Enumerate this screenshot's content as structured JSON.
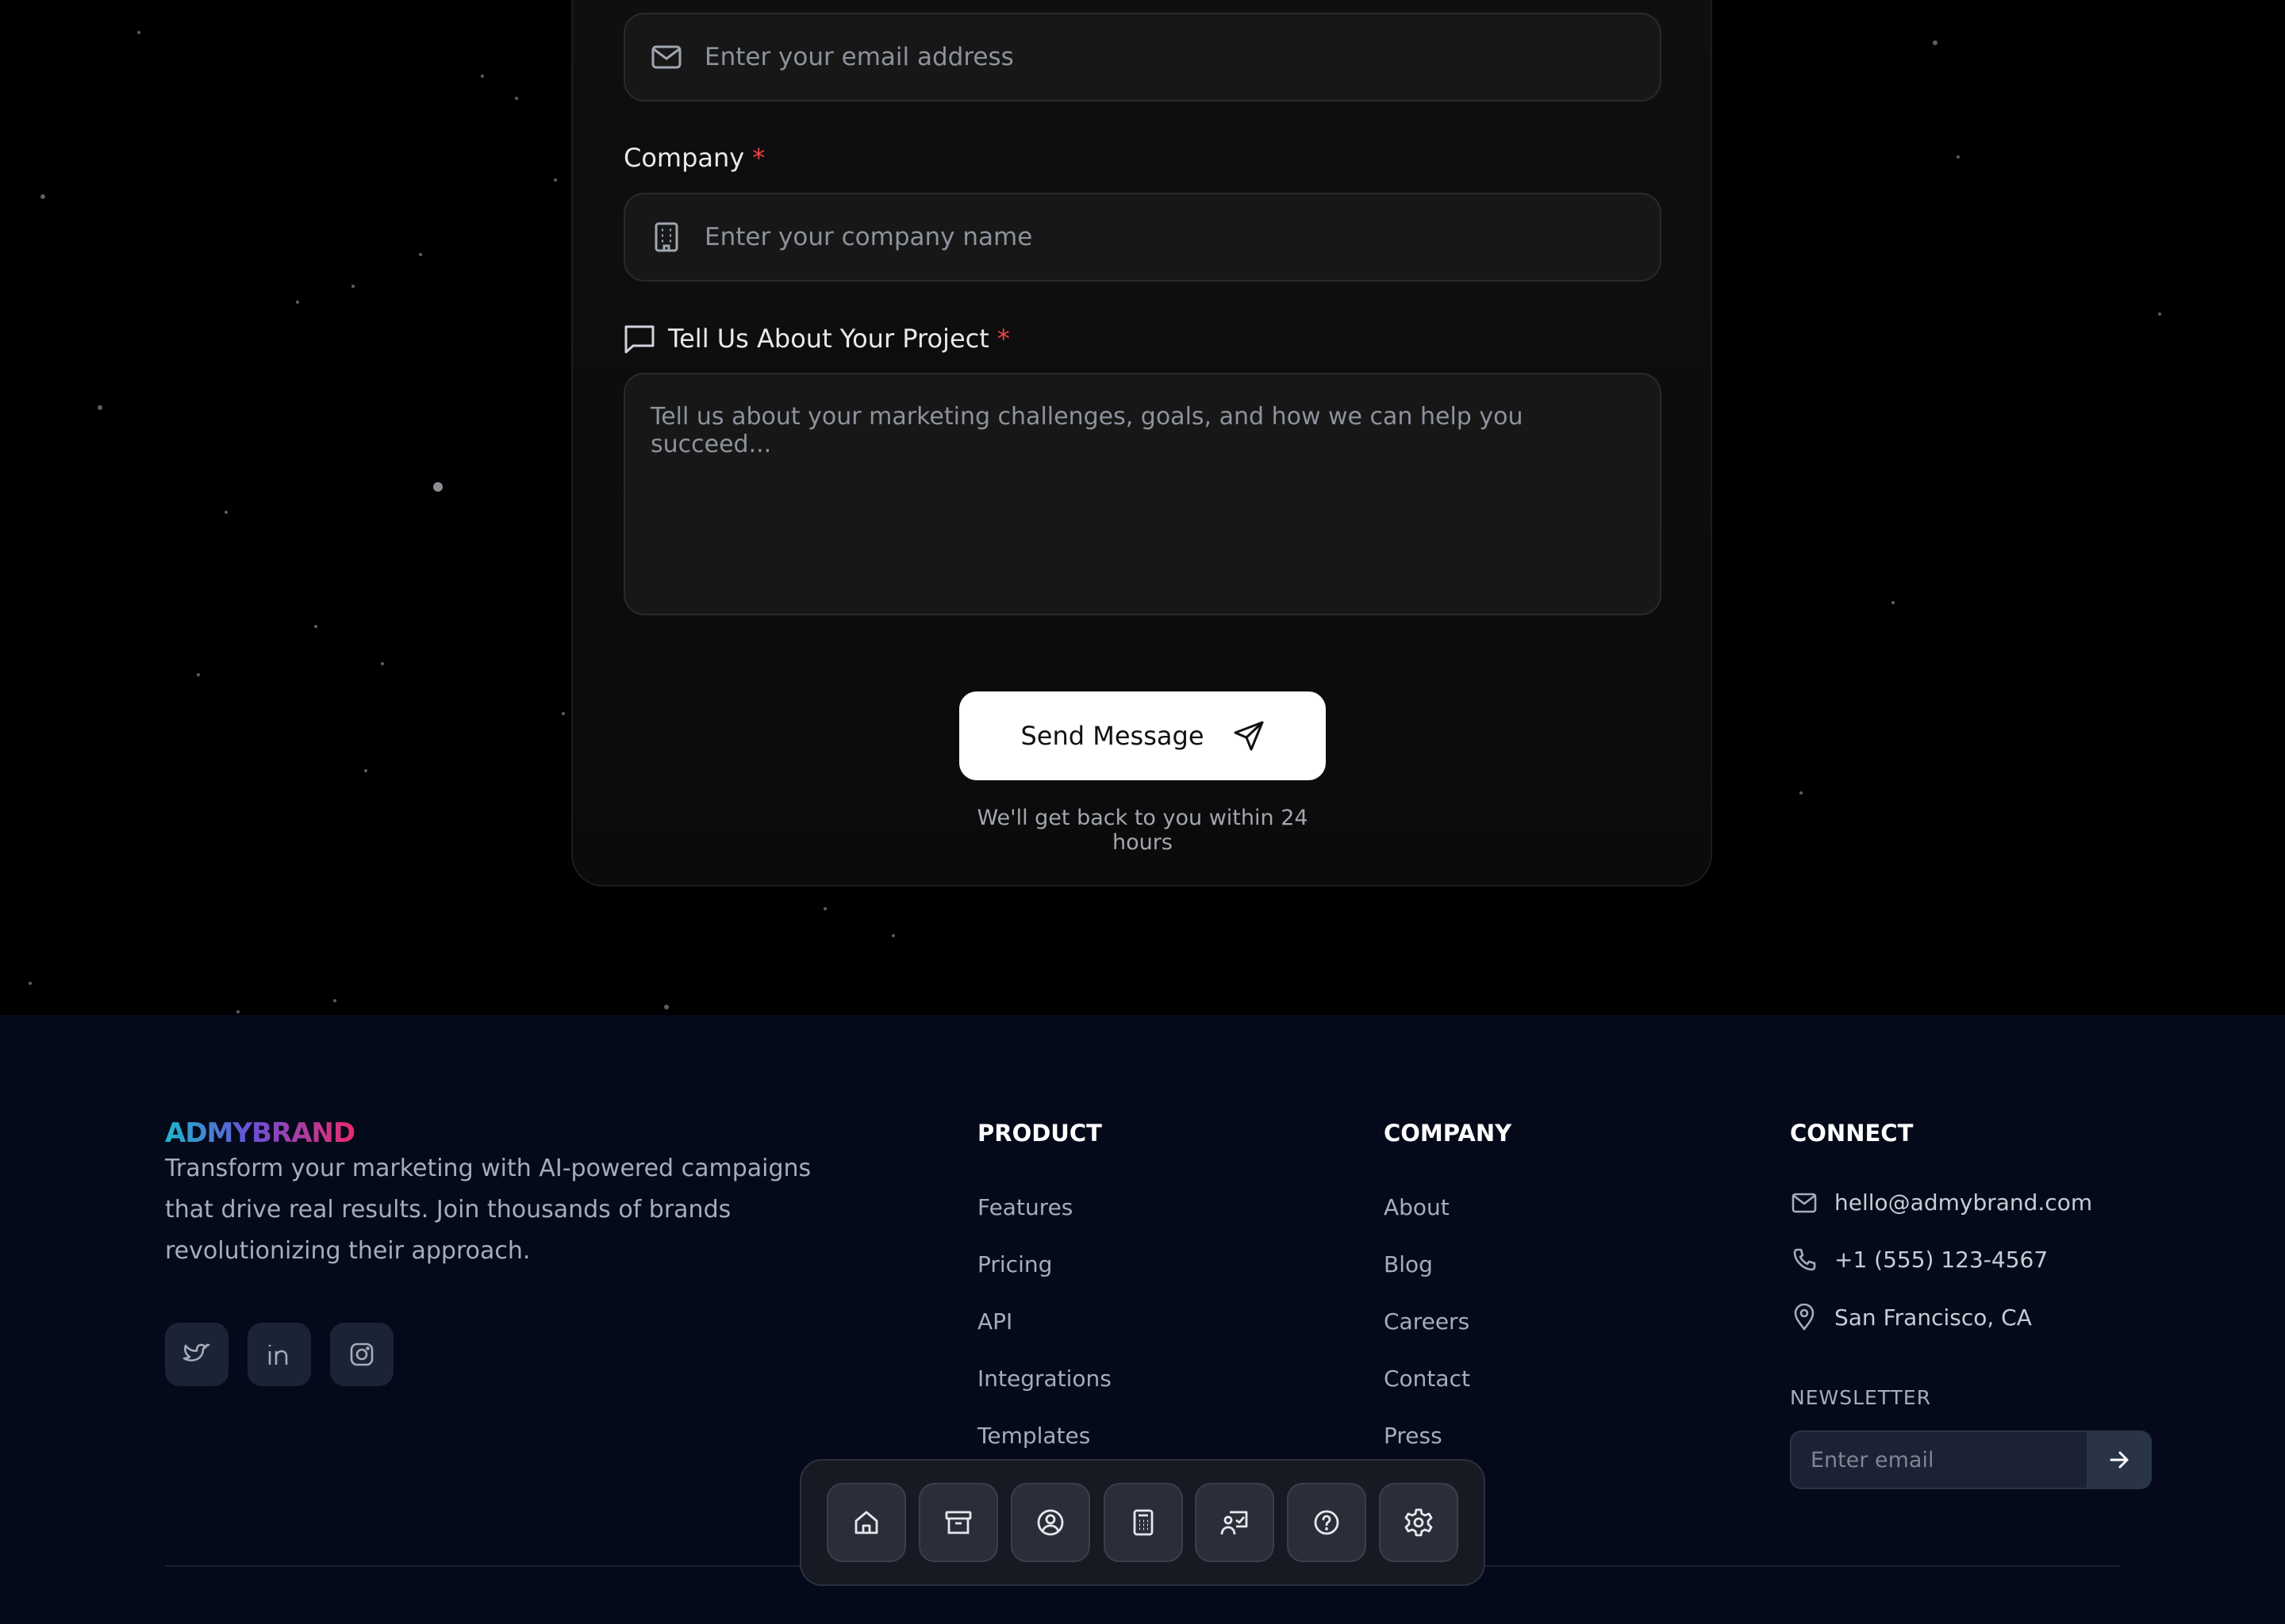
{
  "form": {
    "email_placeholder": "Enter your email address",
    "company_label": "Company",
    "company_required": "*",
    "company_placeholder": "Enter your company name",
    "project_label": "Tell Us About Your Project",
    "project_required": "*",
    "project_placeholder": "Tell us about your marketing challenges, goals, and how we can help you succeed...",
    "send_label": "Send Message",
    "response_note": "We'll get back to you within 24 hours"
  },
  "footer": {
    "brand": "ADMYBRAND",
    "description": "Transform your marketing with AI-powered campaigns that drive real results. Join thousands of brands revolutionizing their approach.",
    "social_icons": [
      "twitter-icon",
      "linkedin-icon",
      "instagram-icon"
    ],
    "product": {
      "heading": "PRODUCT",
      "links": [
        "Features",
        "Pricing",
        "API",
        "Integrations",
        "Templates"
      ]
    },
    "company": {
      "heading": "COMPANY",
      "links": [
        "About",
        "Blog",
        "Careers",
        "Contact",
        "Press"
      ]
    },
    "connect": {
      "heading": "CONNECT",
      "email": "hello@admybrand.com",
      "phone": "+1 (555) 123-4567",
      "location": "San Francisco, CA",
      "newsletter_heading": "NEWSLETTER",
      "newsletter_placeholder": "Enter email"
    }
  },
  "dock": {
    "icons": [
      "home-icon",
      "archive-icon",
      "user-circle-icon",
      "calculator-icon",
      "presentation-icon",
      "help-icon",
      "settings-icon"
    ]
  },
  "colors": {
    "background": "#000000",
    "footer_bg": "#050a1a",
    "required": "#ef4444",
    "brand_gradient_start": "#1fb6c9",
    "brand_gradient_end": "#ec2a6a"
  }
}
